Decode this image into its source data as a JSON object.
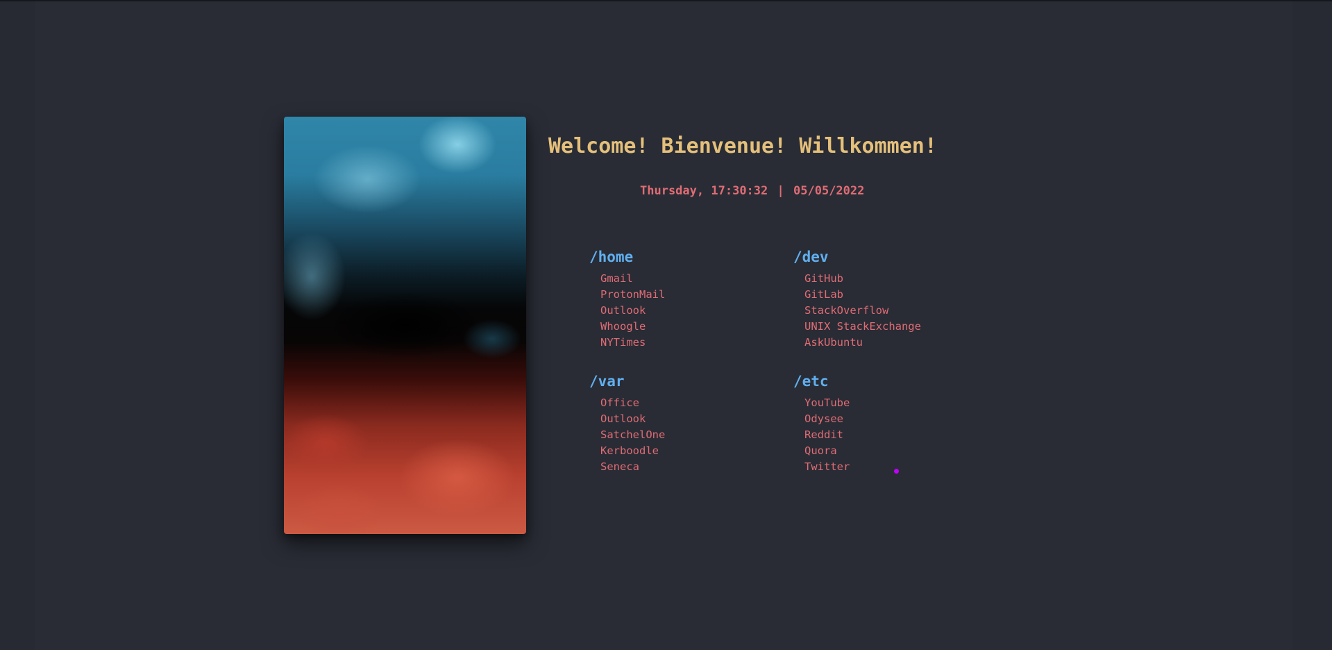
{
  "page": {
    "title": "Welcome! Bienvenue! Willkommen!",
    "datetime": {
      "day": "Thursday,",
      "time": "17:30:32",
      "separator": "|",
      "date": "05/05/2022"
    }
  },
  "colors": {
    "background": "#272a32",
    "title": "#e5c07b",
    "heading": "#61afef",
    "link": "#e06c75",
    "cursor": "#c200ff"
  },
  "groups": {
    "home": {
      "heading": "/home",
      "links": [
        "Gmail",
        "ProtonMail",
        "Outlook",
        "Whoogle",
        "NYTimes"
      ]
    },
    "dev": {
      "heading": "/dev",
      "links": [
        "GitHub",
        "GitLab",
        "StackOverflow",
        "UNIX StackExchange",
        "AskUbuntu"
      ]
    },
    "var": {
      "heading": "/var",
      "links": [
        "Office",
        "Outlook",
        "SatchelOne",
        "Kerboodle",
        "Seneca"
      ]
    },
    "etc": {
      "heading": "/etc",
      "links": [
        "YouTube",
        "Odysee",
        "Reddit",
        "Quora",
        "Twitter"
      ]
    }
  },
  "image": {
    "icon": "fluid-art-image"
  }
}
